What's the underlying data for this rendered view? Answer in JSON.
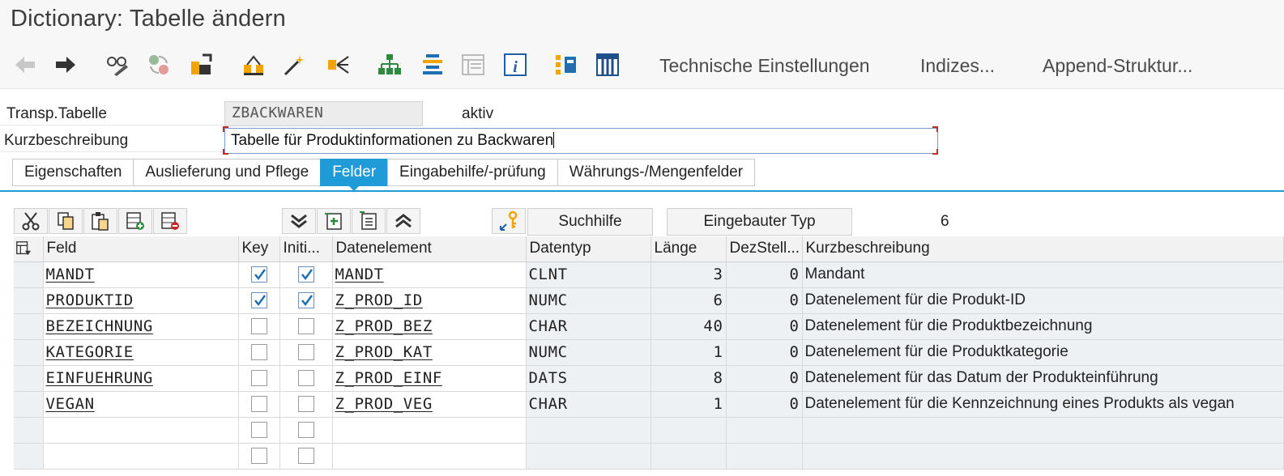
{
  "window": {
    "title": "Dictionary: Tabelle ändern"
  },
  "toolbar": {
    "technical_settings": "Technische Einstellungen",
    "indexes": "Indizes...",
    "append_structure": "Append-Struktur..."
  },
  "header": {
    "table_label": "Transp.Tabelle",
    "table_name": "ZBACKWAREN",
    "status": "aktiv",
    "short_desc_label": "Kurzbeschreibung",
    "short_desc_value": "Tabelle für Produktinformationen zu Backwaren"
  },
  "tabs": [
    {
      "label": "Eigenschaften",
      "active": false
    },
    {
      "label": "Auslieferung und Pflege",
      "active": false
    },
    {
      "label": "Felder",
      "active": true
    },
    {
      "label": "Eingabehilfe/-prüfung",
      "active": false
    },
    {
      "label": "Währungs-/Mengenfelder",
      "active": false
    }
  ],
  "grid_toolbar": {
    "search_help": "Suchhilfe",
    "builtin_type": "Eingebauter Typ",
    "count": "6"
  },
  "columns": [
    "Feld",
    "Key",
    "Initi...",
    "Datenelement",
    "Datentyp",
    "Länge",
    "DezStell...",
    "Kurzbeschreibung"
  ],
  "rows": [
    {
      "field": "MANDT",
      "key": true,
      "init": true,
      "data_element": "MANDT",
      "data_type": "CLNT",
      "length": "3",
      "decimals": "0",
      "desc": "Mandant"
    },
    {
      "field": "PRODUKTID",
      "key": true,
      "init": true,
      "data_element": "Z_PROD_ID",
      "data_type": "NUMC",
      "length": "6",
      "decimals": "0",
      "desc": "Datenelement für die Produkt-ID"
    },
    {
      "field": "BEZEICHNUNG",
      "key": false,
      "init": false,
      "data_element": "Z_PROD_BEZ",
      "data_type": "CHAR",
      "length": "40",
      "decimals": "0",
      "desc": "Datenelement für die Produktbezeichnung"
    },
    {
      "field": "KATEGORIE",
      "key": false,
      "init": false,
      "data_element": "Z_PROD_KAT",
      "data_type": "NUMC",
      "length": "1",
      "decimals": "0",
      "desc": "Datenelement für die Produktkategorie"
    },
    {
      "field": "EINFUEHRUNG",
      "key": false,
      "init": false,
      "data_element": "Z_PROD_EINF",
      "data_type": "DATS",
      "length": "8",
      "decimals": "0",
      "desc": "Datenelement für das Datum der Produkteinführung"
    },
    {
      "field": "VEGAN",
      "key": false,
      "init": false,
      "data_element": "Z_PROD_VEG",
      "data_type": "CHAR",
      "length": "1",
      "decimals": "0",
      "desc": "Datenelement für die Kennzeichnung eines Produkts als vegan"
    },
    {
      "field": "",
      "key": false,
      "init": false,
      "data_element": "",
      "data_type": "",
      "length": "",
      "decimals": "",
      "desc": ""
    },
    {
      "field": "",
      "key": false,
      "init": false,
      "data_element": "",
      "data_type": "",
      "length": "",
      "decimals": "",
      "desc": ""
    }
  ],
  "colors": {
    "accent": "#1f9bd8",
    "field_ro": "#ececec",
    "grid_ro": "#eef1f4"
  }
}
